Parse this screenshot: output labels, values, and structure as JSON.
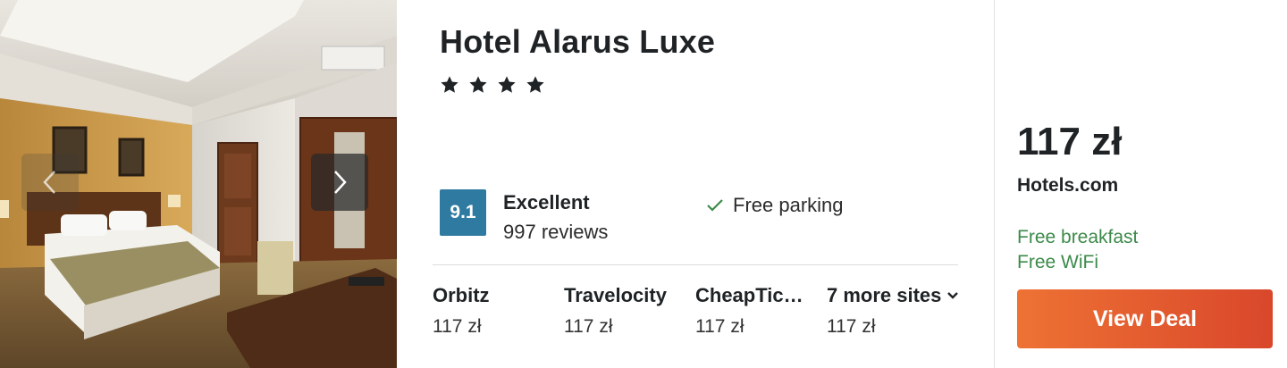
{
  "photo": {
    "alt_semantic": "hotel-room-photo",
    "prev_icon": "chevron-left-icon",
    "next_icon": "chevron-right-icon"
  },
  "hotel": {
    "name": "Hotel Alarus Luxe",
    "star_rating": 4,
    "star_icon": "star-icon"
  },
  "rating": {
    "score": "9.1",
    "label": "Excellent",
    "reviews": "997 reviews",
    "badge_color": "#2f7aa0"
  },
  "amenities": [
    {
      "icon": "checkmark-icon",
      "label": "Free parking"
    }
  ],
  "providers": [
    {
      "name": "Orbitz",
      "price": "117 zł"
    },
    {
      "name": "Travelocity",
      "price": "117 zł"
    },
    {
      "name": "CheapTic…",
      "price": "117 zł"
    }
  ],
  "more_sites": {
    "label": "7 more sites",
    "price": "117 zł",
    "icon": "chevron-down-icon"
  },
  "deal": {
    "price": "117 zł",
    "site": "Hotels.com",
    "perks": [
      "Free breakfast",
      "Free WiFi"
    ],
    "perk_color": "#3c8a4a",
    "button_label": "View Deal",
    "button_color": "#e85c2f"
  }
}
